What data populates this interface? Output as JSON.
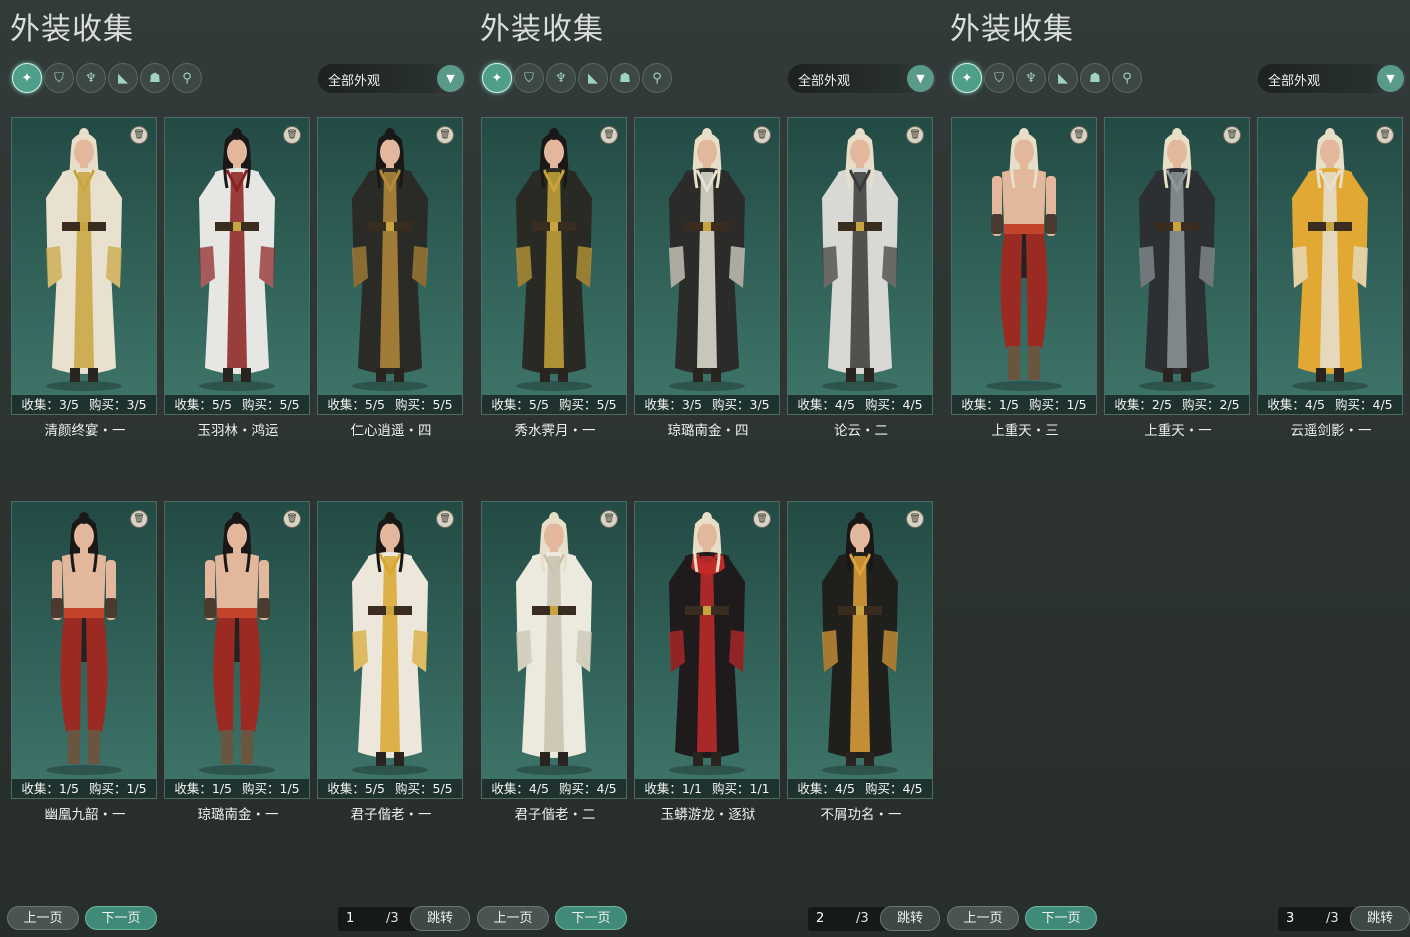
{
  "panel_title": "外装收集",
  "dropdown_value": "全部外观",
  "nav": {
    "prev": "上一页",
    "next": "下一页",
    "jump": "跳转",
    "total": "/3"
  },
  "category_icons": [
    "outfit-icon",
    "hat-icon",
    "top-icon",
    "shoe-icon",
    "mask-icon",
    "accessory-icon"
  ],
  "colors": {
    "accent": "#4f9e8a",
    "card_top": "#234a44",
    "card_bottom": "#3f756a",
    "bg": "#2b3230"
  },
  "panels": [
    {
      "page": "1",
      "cards": [
        {
          "name": "清颜终宴・一",
          "collect": "收集：3/5",
          "buy": "购买：3/5",
          "outfit": "gold",
          "hair": "blond"
        },
        {
          "name": "玉羽林・鸿运",
          "collect": "收集：5/5",
          "buy": "购买：5/5",
          "outfit": "white",
          "hair": "black"
        },
        {
          "name": "仁心逍遥・四",
          "collect": "收集：5/5",
          "buy": "购买：5/5",
          "outfit": "dark",
          "hair": "black"
        },
        {
          "name": "幽凰九韶・一",
          "collect": "收集：1/5",
          "buy": "购买：1/5",
          "outfit": "shirtless",
          "hair": "black"
        },
        {
          "name": "琼璐南金・一",
          "collect": "收集：1/5",
          "buy": "购买：1/5",
          "outfit": "shirtless",
          "hair": "black"
        },
        {
          "name": "君子偕老・一",
          "collect": "收集：5/5",
          "buy": "购买：5/5",
          "outfit": "yellow",
          "hair": "black"
        }
      ]
    },
    {
      "page": "2",
      "cards": [
        {
          "name": "秀水霁月・一",
          "collect": "收集：5/5",
          "buy": "购买：5/5",
          "outfit": "goldblack",
          "hair": "black"
        },
        {
          "name": "琼璐南金・四",
          "collect": "收集：3/5",
          "buy": "购买：3/5",
          "outfit": "darkwhite",
          "hair": "blond"
        },
        {
          "name": "论云・二",
          "collect": "收集：4/5",
          "buy": "购买：4/5",
          "outfit": "grey",
          "hair": "blond"
        },
        {
          "name": "君子偕老・二",
          "collect": "收集：4/5",
          "buy": "购买：4/5",
          "outfit": "cream",
          "hair": "blond"
        },
        {
          "name": "玉蟒游龙・逐狱",
          "collect": "收集：1/1",
          "buy": "购买：1/1",
          "outfit": "redblack",
          "hair": "blond"
        },
        {
          "name": "不屑功名・一",
          "collect": "收集：4/5",
          "buy": "购买：4/5",
          "outfit": "orange",
          "hair": "black"
        }
      ]
    },
    {
      "page": "3",
      "cards": [
        {
          "name": "上重天・三",
          "collect": "收集：1/5",
          "buy": "购买：1/5",
          "outfit": "shirtless",
          "hair": "blond"
        },
        {
          "name": "上重天・一",
          "collect": "收集：2/5",
          "buy": "购买：2/5",
          "outfit": "darkgrey",
          "hair": "blond"
        },
        {
          "name": "云遥剑影・一",
          "collect": "收集：4/5",
          "buy": "购买：4/5",
          "outfit": "amber",
          "hair": "blond"
        }
      ]
    }
  ]
}
